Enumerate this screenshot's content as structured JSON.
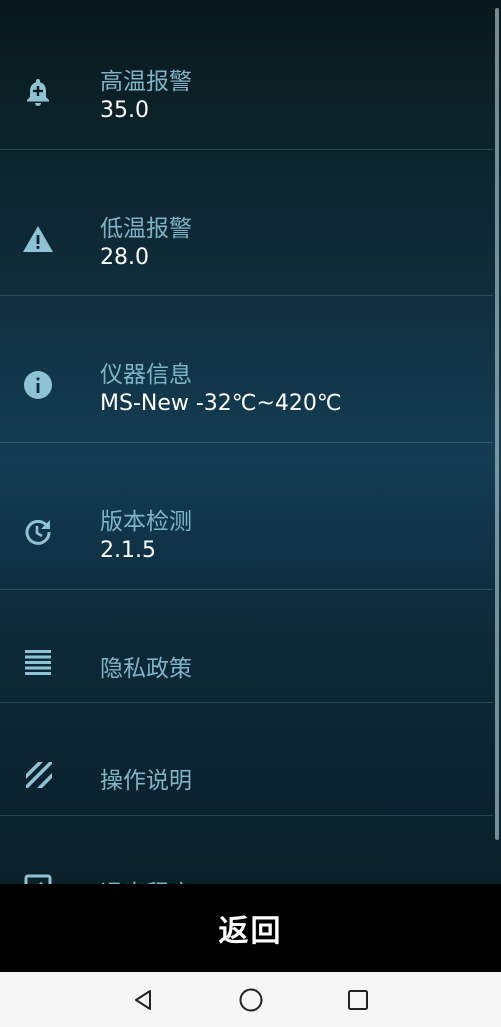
{
  "settings": {
    "items": [
      {
        "icon": "bell-plus-icon",
        "title": "高温报警",
        "value": "35.0"
      },
      {
        "icon": "warning-icon",
        "title": "低温报警",
        "value": "28.0"
      },
      {
        "icon": "info-icon",
        "title": "仪器信息",
        "value": "MS-New -32℃~420℃"
      },
      {
        "icon": "update-icon",
        "title": "版本检测",
        "value": "2.1.5"
      },
      {
        "icon": "list-icon",
        "title": "隐私政策",
        "value": ""
      },
      {
        "icon": "stripes-icon",
        "title": "操作说明",
        "value": ""
      },
      {
        "icon": "exit-icon",
        "title": "退出程序",
        "value": ""
      }
    ]
  },
  "footer": {
    "back_label": "返回"
  },
  "navbar": {
    "back": "nav-back-icon",
    "home": "nav-home-icon",
    "recents": "nav-recents-icon"
  },
  "colors": {
    "title": "#7fb3c7",
    "value": "#ffffff",
    "icon": "#8ec3d6",
    "footer_bg": "#000000",
    "navbar_bg": "#f6f6f6"
  }
}
